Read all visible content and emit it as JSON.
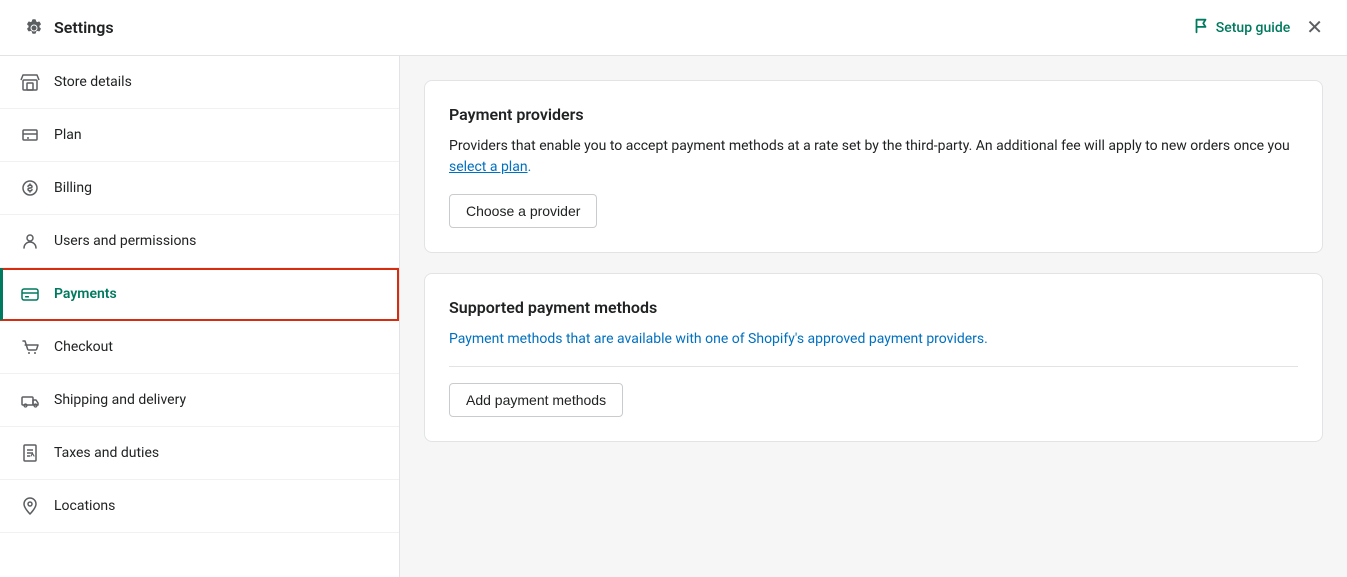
{
  "header": {
    "title": "Settings",
    "setup_guide_label": "Setup guide",
    "close_label": "✕"
  },
  "sidebar": {
    "items": [
      {
        "id": "store-details",
        "label": "Store details",
        "icon": "store"
      },
      {
        "id": "plan",
        "label": "Plan",
        "icon": "plan"
      },
      {
        "id": "billing",
        "label": "Billing",
        "icon": "billing"
      },
      {
        "id": "users-permissions",
        "label": "Users and permissions",
        "icon": "users"
      },
      {
        "id": "payments",
        "label": "Payments",
        "icon": "payments",
        "active": true
      },
      {
        "id": "checkout",
        "label": "Checkout",
        "icon": "checkout"
      },
      {
        "id": "shipping-delivery",
        "label": "Shipping and delivery",
        "icon": "shipping"
      },
      {
        "id": "taxes-duties",
        "label": "Taxes and duties",
        "icon": "taxes"
      },
      {
        "id": "locations",
        "label": "Locations",
        "icon": "locations"
      }
    ]
  },
  "main": {
    "payment_providers": {
      "title": "Payment providers",
      "description_prefix": "Providers that enable you to accept payment methods at a rate set by the third-party. An additional fee will apply to new orders once you ",
      "description_link": "select a plan",
      "description_suffix": ".",
      "choose_provider_btn": "Choose a provider"
    },
    "supported_payment_methods": {
      "title": "Supported payment methods",
      "description": "Payment methods that are available with one of Shopify's approved payment providers.",
      "add_btn": "Add payment methods"
    }
  }
}
